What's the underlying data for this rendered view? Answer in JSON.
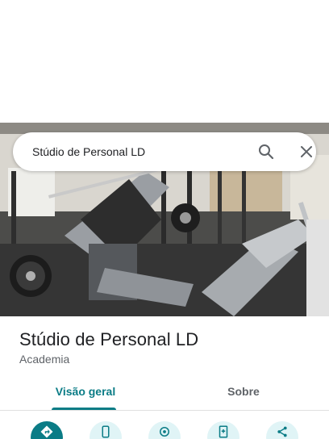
{
  "search": {
    "query": "Stúdio de Personal LD"
  },
  "place": {
    "name": "Stúdio de Personal LD",
    "category": "Academia"
  },
  "tabs": [
    {
      "label": "Visão geral",
      "selected": true
    },
    {
      "label": "Sobre",
      "selected": false
    }
  ],
  "actions": [
    {
      "icon": "directions-icon"
    },
    {
      "icon": "phone-icon"
    },
    {
      "icon": "location-pin-icon"
    },
    {
      "icon": "save-icon"
    },
    {
      "icon": "share-icon"
    }
  ],
  "colors": {
    "accent": "#0b7c86",
    "accent_light": "#e0f4f6",
    "text": "#202124",
    "secondary": "#5f6368"
  }
}
